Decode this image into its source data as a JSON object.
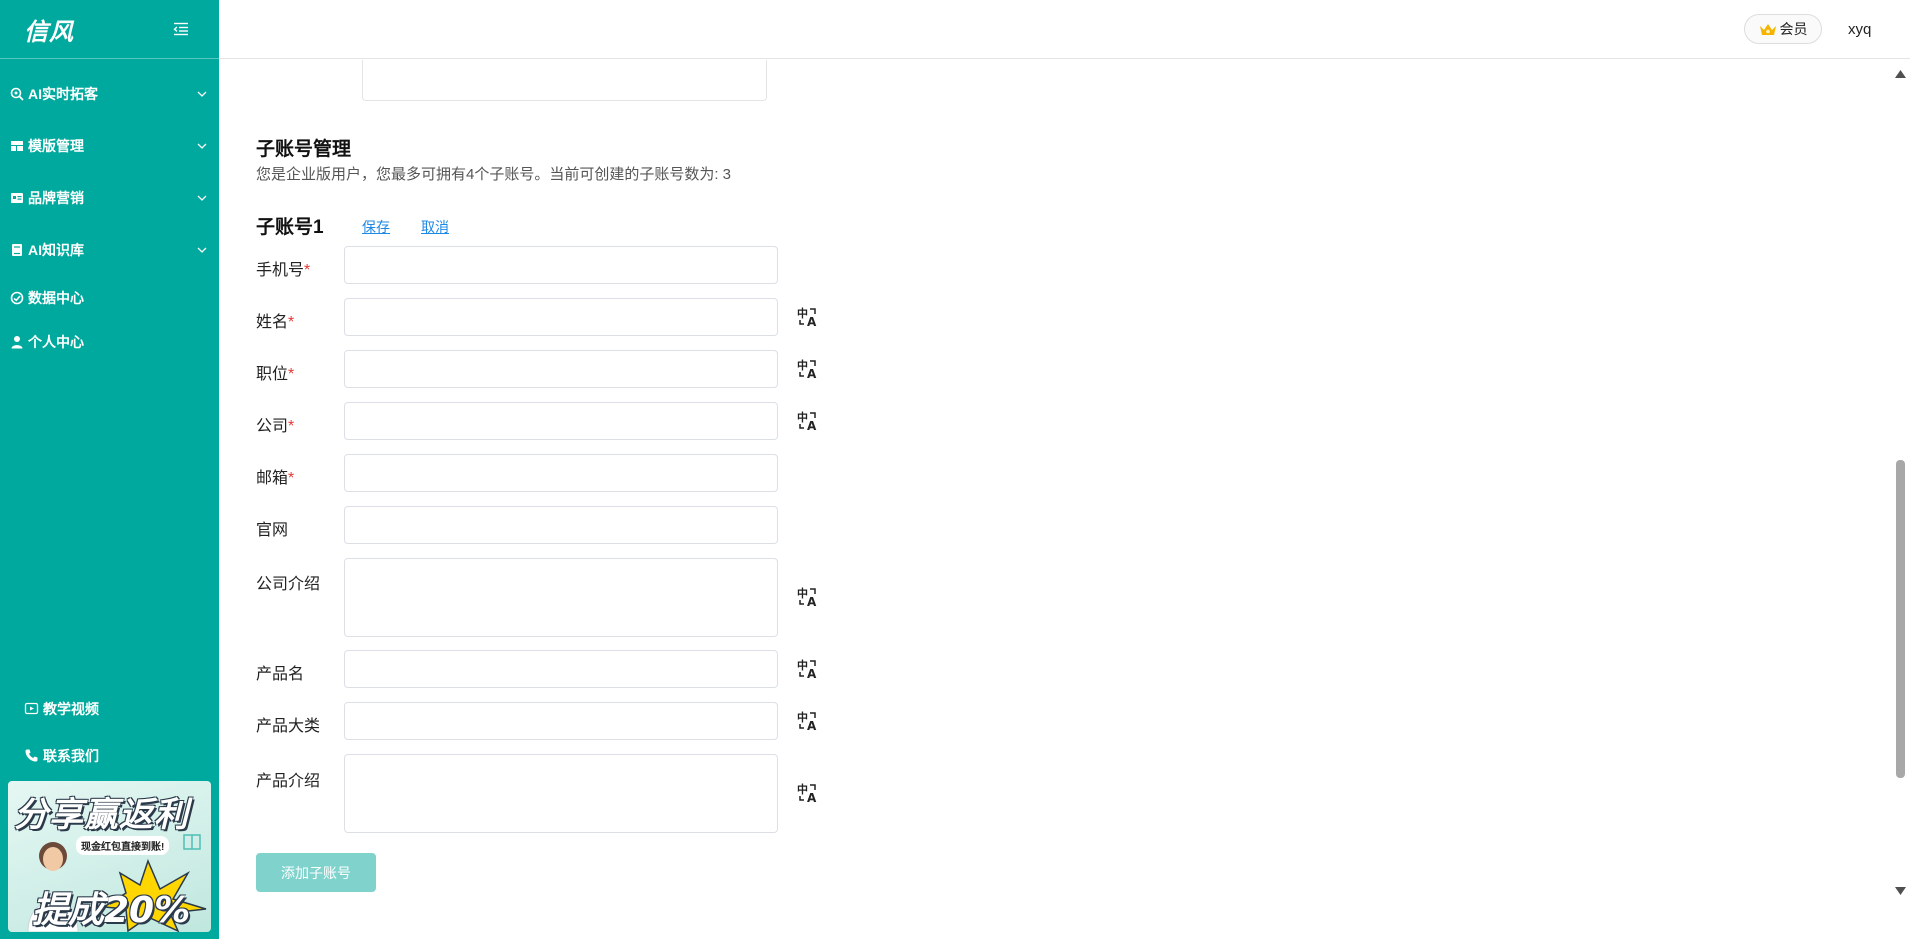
{
  "sidebar": {
    "logo": "信风",
    "items": [
      {
        "label": "AI实时拓客",
        "icon": "search-target-icon",
        "expandable": true
      },
      {
        "label": "模版管理",
        "icon": "layout-icon",
        "expandable": true
      },
      {
        "label": "品牌营销",
        "icon": "id-card-icon",
        "expandable": true
      },
      {
        "label": "AI知识库",
        "icon": "book-icon",
        "expandable": true
      },
      {
        "label": "数据中心",
        "icon": "check-circle-icon",
        "expandable": false
      },
      {
        "label": "个人中心",
        "icon": "user-icon",
        "expandable": false
      }
    ],
    "bottom_links": [
      {
        "label": "教学视频",
        "icon": "video-icon"
      },
      {
        "label": "联系我们",
        "icon": "phone-icon"
      }
    ],
    "promo": {
      "title": "分享赢返利",
      "subtitle": "现金红包直接到账!",
      "rate": "提成20%"
    }
  },
  "header": {
    "member_label": "会员",
    "username": "xyq"
  },
  "main": {
    "section_title": "子账号管理",
    "section_desc": "您是企业版用户，您最多可拥有4个子账号。当前可创建的子账号数为: 3",
    "account_title": "子账号1",
    "save_label": "保存",
    "cancel_label": "取消",
    "fields": [
      {
        "label": "手机号",
        "required": true,
        "value": "",
        "translate": false
      },
      {
        "label": "姓名",
        "required": true,
        "value": "",
        "translate": true
      },
      {
        "label": "职位",
        "required": true,
        "value": "",
        "translate": true
      },
      {
        "label": "公司",
        "required": true,
        "value": "",
        "translate": true
      },
      {
        "label": "邮箱",
        "required": true,
        "value": "",
        "translate": false
      },
      {
        "label": "官网",
        "required": false,
        "value": "",
        "translate": false
      },
      {
        "label": "公司介绍",
        "required": false,
        "value": "",
        "translate": true
      },
      {
        "label": "产品名",
        "required": false,
        "value": "",
        "translate": true
      },
      {
        "label": "产品大类",
        "required": false,
        "value": "",
        "translate": true
      },
      {
        "label": "产品介绍",
        "required": false,
        "value": "",
        "translate": true
      }
    ],
    "required_mark": "*",
    "add_button_label": "添加子账号"
  },
  "colors": {
    "sidebar_bg": "#00a99d",
    "link": "#1e88e5",
    "required": "#e53935",
    "add_button_disabled": "#7fd3cc"
  }
}
